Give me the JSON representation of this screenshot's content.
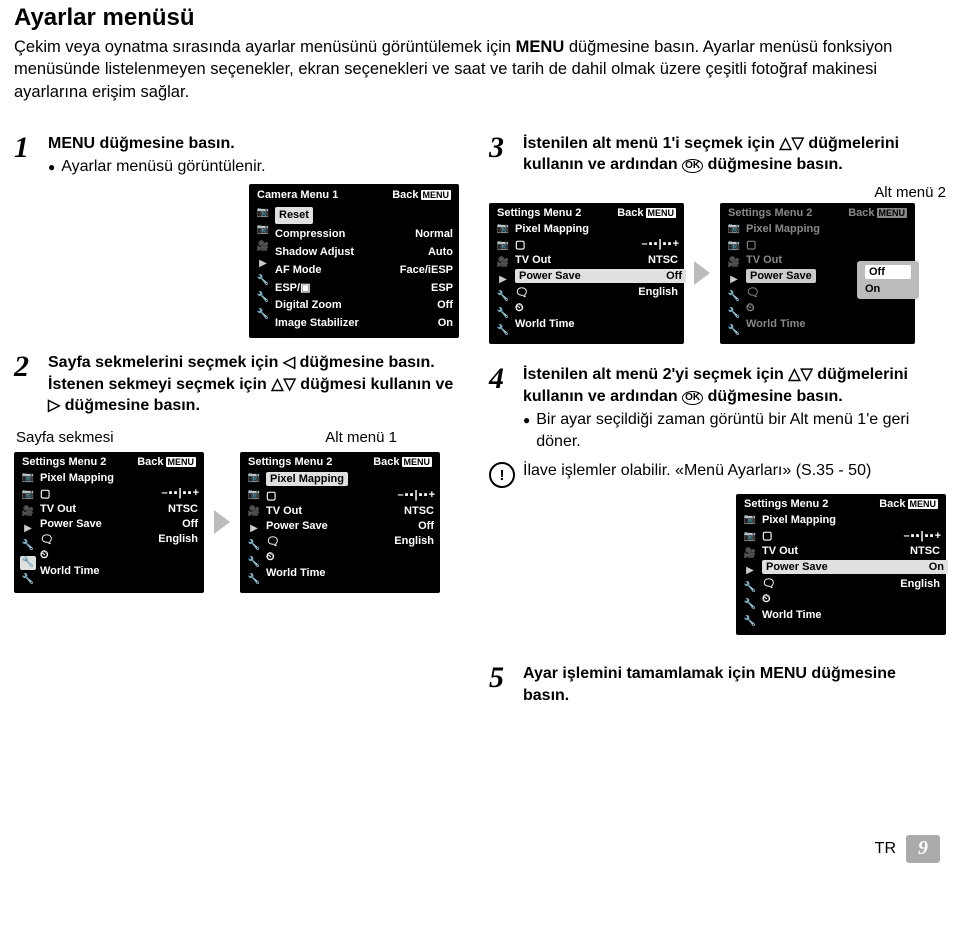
{
  "title": "Ayarlar menüsü",
  "intro": "Çekim veya oynatma sırasında ayarlar menüsünü görüntülemek için MENU düğmesine basın. Ayarlar menüsü fonksiyon menüsünde listelenmeyen seçenekler, ekran seçenekleri ve saat ve tarih de dahil olmak üzere çeşitli fotoğraf makinesi ayarlarına erişim sağlar.",
  "steps": {
    "s1": {
      "num": "1",
      "head": "MENU düğmesine basın.",
      "bullet": "Ayarlar menüsü görüntülenir."
    },
    "s2": {
      "num": "2",
      "text": "Sayfa sekmelerini seçmek için ◁ düğmesine basın. İstenen sekmeyi seçmek için △▽ düğmesi kullanın ve ▷ düğmesine basın."
    },
    "s3": {
      "num": "3",
      "text": "İstenilen alt menü 1'i seçmek için △▽ düğmelerini kullanın ve ardından OK düğmesine basın."
    },
    "s4": {
      "num": "4",
      "text": "İstenilen alt menü 2'yi seçmek için △▽ düğmelerini kullanın ve ardından OK düğmesine basın.",
      "bullet": "Bir ayar seçildiği zaman görüntü bir Alt menü 1'e geri döner."
    },
    "s5": {
      "num": "5",
      "text": "Ayar işlemini tamamlamak için MENU düğmesine basın."
    }
  },
  "captions": {
    "page_tab": "Sayfa sekmesi",
    "alt1": "Alt menü 1",
    "alt2": "Alt menü 2"
  },
  "note": "İlave işlemler olabilir. «Menü Ayarları» (S.35 - 50)",
  "panel_common": {
    "back": "Back",
    "menu_tag": "MENU"
  },
  "camera_menu": {
    "title": "Camera Menu 1",
    "rows": [
      {
        "label": "Reset",
        "value": "",
        "hl": true
      },
      {
        "label": "Compression",
        "value": "Normal"
      },
      {
        "label": "Shadow Adjust",
        "value": "Auto"
      },
      {
        "label": "AF Mode",
        "value": "Face/iESP"
      },
      {
        "label": "ESP/▣",
        "value": "ESP"
      },
      {
        "label": "Digital Zoom",
        "value": "Off"
      },
      {
        "label": "Image Stabilizer",
        "value": "On"
      }
    ]
  },
  "settings_menu": {
    "title": "Settings Menu 2",
    "rows": [
      {
        "label": "Pixel Mapping",
        "value": ""
      },
      {
        "label": "▢",
        "value": "– ▪ ▪ | ▪ ▪ +",
        "bright": true
      },
      {
        "label": "TV Out",
        "value": "NTSC"
      },
      {
        "label": "Power Save",
        "value": "Off"
      },
      {
        "label": "🗨",
        "value": "English"
      },
      {
        "label": "⏲",
        "value": ""
      },
      {
        "label": "World Time",
        "value": ""
      }
    ]
  },
  "settings_menu_on": {
    "title": "Settings Menu 2",
    "rows": [
      {
        "label": "Pixel Mapping",
        "value": ""
      },
      {
        "label": "▢",
        "value": "– ▪ ▪ | ▪ ▪ +",
        "bright": true
      },
      {
        "label": "TV Out",
        "value": "NTSC"
      },
      {
        "label": "Power Save",
        "value": "On"
      },
      {
        "label": "🗨",
        "value": "English"
      },
      {
        "label": "⏲",
        "value": ""
      },
      {
        "label": "World Time",
        "value": ""
      }
    ]
  },
  "sub2_popup": {
    "opt1": "Off",
    "opt2": "On"
  },
  "footer": {
    "lang": "TR",
    "page": "9"
  }
}
